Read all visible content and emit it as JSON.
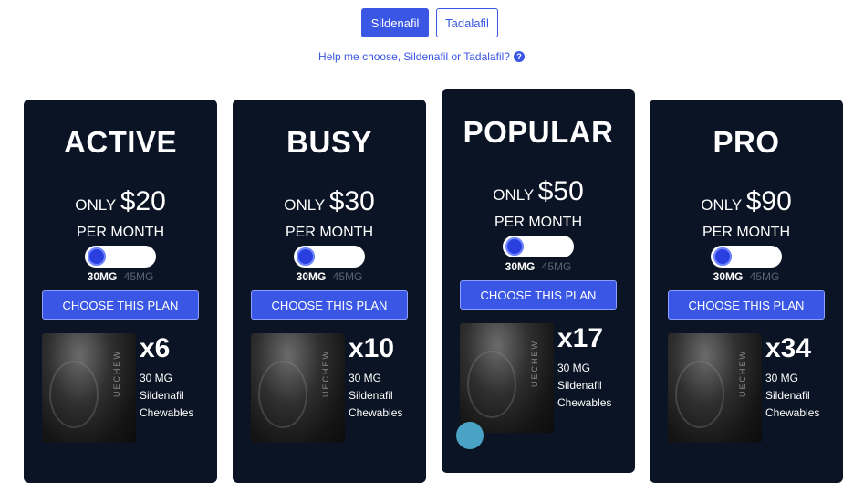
{
  "drug_toggle": {
    "options": [
      "Sildenafil",
      "Tadalafil"
    ],
    "selected": "Sildenafil"
  },
  "help_link": "Help me choose, Sildenafil or Tadalafil?",
  "help_icon": "question-circle-icon",
  "plans": [
    {
      "name": "ACTIVE",
      "only": "ONLY",
      "price": "$20",
      "period": "PER MONTH",
      "dose_selected": "30MG",
      "dose_other": "45MG",
      "button": "CHOOSE THIS PLAN",
      "quantity": "x6",
      "desc": [
        "30 MG",
        "Sildenafil",
        "Chewables"
      ],
      "product_brand": "UECHEW"
    },
    {
      "name": "BUSY",
      "only": "ONLY",
      "price": "$30",
      "period": "PER MONTH",
      "dose_selected": "30MG",
      "dose_other": "45MG",
      "button": "CHOOSE THIS PLAN",
      "quantity": "x10",
      "desc": [
        "30 MG",
        "Sildenafil",
        "Chewables"
      ],
      "product_brand": "UECHEW"
    },
    {
      "name": "POPULAR",
      "only": "ONLY",
      "price": "$50",
      "period": "PER MONTH",
      "dose_selected": "30MG",
      "dose_other": "45MG",
      "button": "CHOOSE THIS PLAN",
      "quantity": "x17",
      "desc": [
        "30 MG",
        "Sildenafil",
        "Chewables"
      ],
      "product_brand": "UECHEW"
    },
    {
      "name": "PRO",
      "only": "ONLY",
      "price": "$90",
      "period": "PER MONTH",
      "dose_selected": "30MG",
      "dose_other": "45MG",
      "button": "CHOOSE THIS PLAN",
      "quantity": "x34",
      "desc": [
        "30 MG",
        "Sildenafil",
        "Chewables"
      ],
      "product_brand": "UECHEW"
    }
  ],
  "colors": {
    "accent": "#3a56e4",
    "card_bg": "#0b1424",
    "dose_inactive": "#5a6373"
  }
}
